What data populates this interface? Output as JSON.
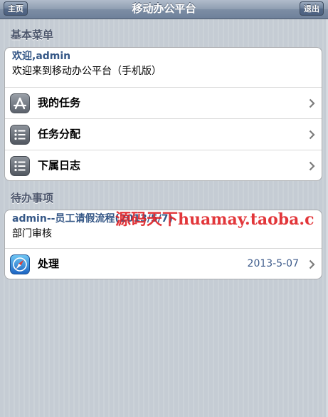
{
  "navbar": {
    "title": "移动办公平台",
    "home_label": "主页",
    "logout_label": "退出"
  },
  "menu_section": {
    "header": "基本菜单",
    "welcome_title": "欢迎,admin",
    "welcome_subtitle": "欢迎来到移动办公平台（手机版）",
    "items": [
      {
        "label": "我的任务",
        "icon": "app-store-icon"
      },
      {
        "label": "任务分配",
        "icon": "list-icon"
      },
      {
        "label": "下属日志",
        "icon": "list-icon"
      }
    ]
  },
  "todo_section": {
    "header": "待办事项",
    "task_title": "admin--员工请假流程(2013/5/7)",
    "task_subtitle": "部门审核",
    "action": {
      "label": "处理",
      "date": "2013-5-07",
      "icon": "safari-compass-icon"
    }
  },
  "watermark": "源码天下huamay.taoba.c",
  "colors": {
    "navbar": "#7d8ea5",
    "background": "#cbd2d8",
    "section_header": "#4c566c",
    "info_title": "#365887",
    "watermark": "#e0262a"
  }
}
